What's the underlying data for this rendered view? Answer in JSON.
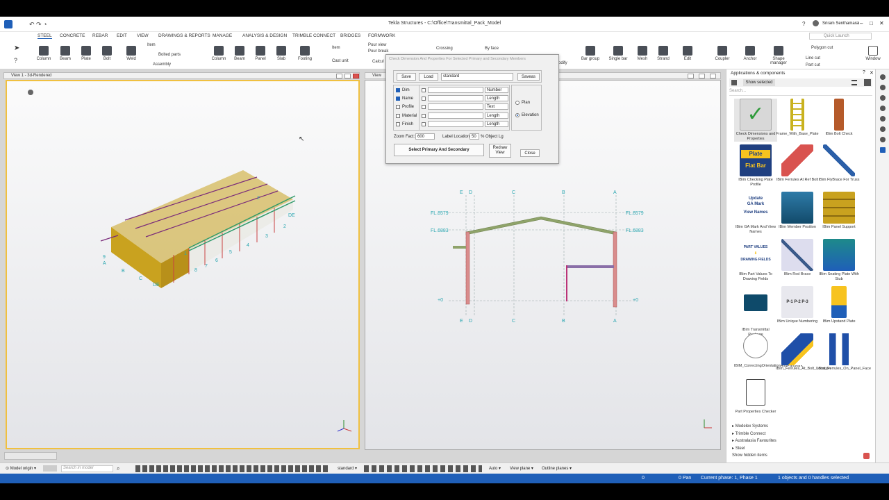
{
  "window": {
    "title": "Tekla Structures - C:\\Office\\Transmittal_Pack_Model",
    "user": "Sriram Senthamarai",
    "quick_launch_placeholder": "Quick Launch"
  },
  "menu": [
    "STEEL",
    "CONCRETE",
    "REBAR",
    "EDIT",
    "VIEW",
    "DRAWINGS & REPORTS",
    "MANAGE",
    "ANALYSIS & DESIGN",
    "TRIMBLE CONNECT",
    "BRIDGES",
    "FORMWORK"
  ],
  "ribbon": {
    "item": "Item",
    "bolted_parts": "Bolted parts",
    "assembly": "Assembly",
    "steel_tools": [
      "Column",
      "Beam",
      "Plate",
      "Bolt",
      "Weld"
    ],
    "concrete_tools": [
      "Column",
      "Beam",
      "Panel",
      "Slab",
      "Footing"
    ],
    "concrete_item": "Item",
    "cast_unit": "Cast unit",
    "pour_view": "Pour view",
    "pour_break": "Pour break",
    "calc": "Calcul",
    "crossing": "Crossing",
    "by_face": "By face",
    "modify": "odify",
    "rebar_tools": [
      "Bar group",
      "Single bar",
      "Mesh",
      "Strand",
      "Edit"
    ],
    "right_tools": [
      "Coupler",
      "Anchor",
      "Shape manager"
    ],
    "polygon_cut": "Polygon cut",
    "line_cut": "Line cut",
    "part_cut": "Part cut",
    "window": "Window"
  },
  "view1": {
    "title": "View 1 - 3d-Rendered"
  },
  "view2": {
    "title": "View"
  },
  "elevation": {
    "grid_top": [
      "E",
      "D",
      "C",
      "B",
      "A"
    ],
    "grid_bottom": [
      "E",
      "D",
      "C",
      "B",
      "A"
    ],
    "levels_left": [
      "FL.8579",
      "FL.6883",
      "+0"
    ],
    "levels_right": [
      "FL.8579",
      "FL.6883",
      "+0"
    ]
  },
  "model3d": {
    "labels": [
      "9",
      "A",
      "B",
      "C",
      "DE",
      "DE",
      "2",
      "3",
      "4",
      "5",
      "6",
      "7",
      "8",
      "2",
      "1"
    ]
  },
  "dialog": {
    "title": "Check Dimension And Properties For Selected Primary and Secondary Members",
    "save": "Save",
    "load": "Load",
    "preset": "standard",
    "saveas": "Saveas",
    "rows": [
      {
        "label": "Dim",
        "checked": true,
        "type": "Number"
      },
      {
        "label": "Name",
        "checked": true,
        "type": "Length"
      },
      {
        "label": "Profile",
        "checked": false,
        "type": "Text"
      },
      {
        "label": "Material",
        "checked": false,
        "type": "Length"
      },
      {
        "label": "Finish",
        "checked": false,
        "type": "Length"
      }
    ],
    "plan": "Plan",
    "elevation": "Elevation",
    "zoom_label": "Zoom Fact:",
    "zoom_value": "600",
    "label_loc": "Label Location:",
    "label_loc_value": "50",
    "object_lg": "% Object Lg",
    "select_btn": "Select Primary And Secondary",
    "redraw": "Redraw View",
    "close": "Close"
  },
  "side": {
    "title": "Applications & components",
    "show_selected": "Show selected",
    "search_placeholder": "Search...",
    "components": [
      "Check Dimensions and Properties",
      "Frame_With_Base_Plate",
      "IBim Bolt Check",
      "IBim Checking Plate Profile",
      "IBim Ferrules At Ref Bolt",
      "IBim FlyBrace For Truss",
      "IBim GA Mark And View Names",
      "IBim Member Position",
      "IBim Panel Support",
      "IBim Part Values To Drawing Fields",
      "IBim Rod Brace",
      "IBim Seating Plate With Stub",
      "IBim Transmittal Package",
      "IBim Unique Numbering",
      "IBim Upstand Plate",
      "IBIM_CorrectingOrientationAndPartMark",
      "IBim_Ferrules_At_Bolt_Location",
      "IBim_Ferrules_On_Panel_Face",
      "Part Properties Checker"
    ],
    "thumb_text": {
      "plate": "Plate",
      "flat_bar": "Flat Bar",
      "ga1": "Update",
      "ga2": "GA Mark",
      "ga3": "View Names",
      "pv1": "PART VALUES",
      "pv2": "DRAWING FIELDS",
      "p1": "P-1",
      "p2": "P-2",
      "p3": "P-3"
    },
    "tree": [
      "Modelex Systems",
      "Trimble Connect",
      "Australasia Favourites",
      "Steel"
    ],
    "show_hidden": "Show hidden items"
  },
  "bottom": {
    "model_origin": "Model origin",
    "search_placeholder": "Search in model",
    "standard": "standard",
    "auto": "Auto",
    "view_plane": "View plane",
    "outline_planes": "Outline planes"
  },
  "status": {
    "zero": "0",
    "pan": "0 Pan",
    "phase": "Current phase: 1, Phase 1",
    "selection": "1 objects and 0 handles selected"
  },
  "colors": {
    "accent": "#1f5fb8",
    "steel_yellow": "#c9a21f",
    "column_red": "#d98c8c",
    "rafter_green": "#8fa36a",
    "grid_cyan": "#2aa6b0"
  }
}
